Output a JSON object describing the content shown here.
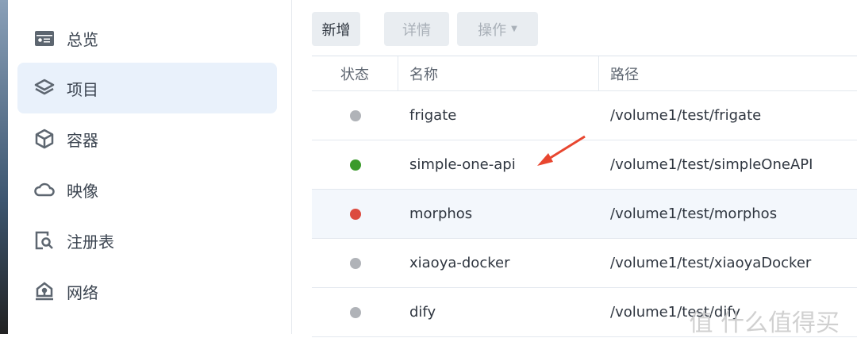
{
  "sidebar": {
    "items": [
      {
        "label": "总览",
        "icon": "overview-card-icon"
      },
      {
        "label": "项目",
        "icon": "layers-icon",
        "active": true
      },
      {
        "label": "容器",
        "icon": "cube-icon"
      },
      {
        "label": "映像",
        "icon": "cloud-icon"
      },
      {
        "label": "注册表",
        "icon": "registry-search-icon"
      },
      {
        "label": "网络",
        "icon": "network-house-icon"
      }
    ]
  },
  "toolbar": {
    "add": "新增",
    "details": "详情",
    "action": "操作"
  },
  "table": {
    "headers": [
      "状态",
      "名称",
      "路径"
    ],
    "rows": [
      {
        "status": "stopped",
        "color": "#b0b3b8",
        "name": "frigate",
        "path": "/volume1/test/frigate"
      },
      {
        "status": "running",
        "color": "#3a9a2b",
        "name": "simple-one-api",
        "path": "/volume1/test/simpleOneAPI"
      },
      {
        "status": "error",
        "color": "#dc4b3f",
        "name": "morphos",
        "path": "/volume1/test/morphos"
      },
      {
        "status": "stopped",
        "color": "#b0b3b8",
        "name": "xiaoya-docker",
        "path": "/volume1/test/xiaoyaDocker"
      },
      {
        "status": "stopped",
        "color": "#b0b3b8",
        "name": "dify",
        "path": "/volume1/test/dify"
      }
    ]
  },
  "watermark": "值 什么值得买",
  "annotation_color": "#e8462f"
}
